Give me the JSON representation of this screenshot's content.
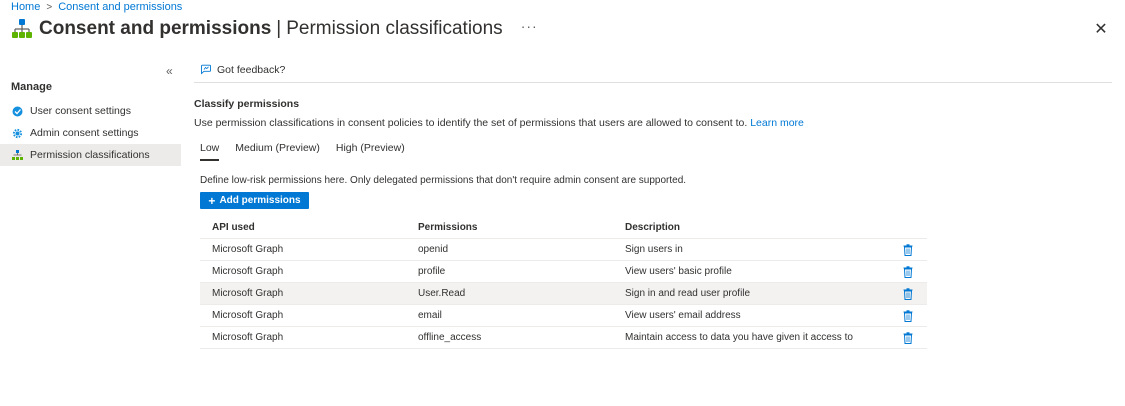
{
  "breadcrumb": {
    "home": "Home",
    "separator": ">",
    "current": "Consent and permissions"
  },
  "header": {
    "title": "Consent and permissions",
    "separator": "|",
    "subtitle": "Permission classifications",
    "more": "···",
    "close": "✕"
  },
  "sidebar": {
    "collapse": "«",
    "heading": "Manage",
    "items": [
      {
        "label": "User consent settings",
        "icon": "user-consent-icon"
      },
      {
        "label": "Admin consent settings",
        "icon": "gear-icon"
      },
      {
        "label": "Permission classifications",
        "icon": "classification-icon",
        "selected": true
      }
    ]
  },
  "toolbar": {
    "feedback_label": "Got feedback?"
  },
  "main": {
    "section_title": "Classify permissions",
    "section_desc": "Use permission classifications in consent policies to identify the set of permissions that users are allowed to consent to.",
    "learn_more": "Learn more",
    "tabs": [
      {
        "label": "Low",
        "active": true
      },
      {
        "label": "Medium (Preview)"
      },
      {
        "label": "High (Preview)"
      }
    ],
    "define_text": "Define low-risk permissions here. Only delegated permissions that don't require admin consent are supported.",
    "add_button": {
      "icon": "+",
      "label": "Add permissions"
    },
    "table": {
      "headers": [
        "API used",
        "Permissions",
        "Description"
      ],
      "rows": [
        {
          "api": "Microsoft Graph",
          "permission": "openid",
          "description": "Sign users in"
        },
        {
          "api": "Microsoft Graph",
          "permission": "profile",
          "description": "View users' basic profile"
        },
        {
          "api": "Microsoft Graph",
          "permission": "User.Read",
          "description": "Sign in and read user profile"
        },
        {
          "api": "Microsoft Graph",
          "permission": "email",
          "description": "View users' email address"
        },
        {
          "api": "Microsoft Graph",
          "permission": "offline_access",
          "description": "Maintain access to data you have given it access to"
        }
      ]
    }
  },
  "colors": {
    "accent": "#0078d4",
    "selected_bg": "#edebe9",
    "hover_bg": "#f3f2f1",
    "text": "#323130"
  }
}
